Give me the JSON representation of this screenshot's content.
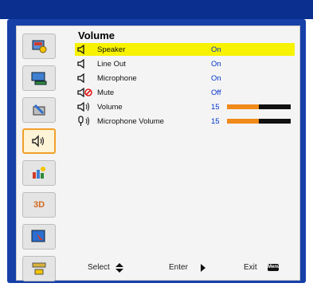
{
  "header": {
    "title": "Volume"
  },
  "sidebar": {
    "items": [
      {
        "icon": "picture-settings-icon",
        "active": false
      },
      {
        "icon": "display-settings-icon",
        "active": false
      },
      {
        "icon": "setup-wrench-icon",
        "active": false
      },
      {
        "icon": "volume-icon",
        "active": true
      },
      {
        "icon": "options-icon",
        "active": false
      },
      {
        "icon": "3d-icon",
        "active": false,
        "text": "3D"
      },
      {
        "icon": "screen-pointer-icon",
        "active": false
      },
      {
        "icon": "network-icon",
        "active": false
      }
    ]
  },
  "menu": {
    "rows": [
      {
        "icon": "speaker-icon",
        "label": "Speaker",
        "value": "On",
        "selected": true
      },
      {
        "icon": "speaker-icon",
        "label": "Line Out",
        "value": "On",
        "selected": false
      },
      {
        "icon": "speaker-icon",
        "label": "Microphone",
        "value": "On",
        "selected": false
      },
      {
        "icon": "mute-icon",
        "label": "Mute",
        "value": "Off",
        "selected": false
      },
      {
        "icon": "volume-level-icon",
        "label": "Volume",
        "value": "15",
        "level": 0.5,
        "selected": false
      },
      {
        "icon": "microphone-volume-icon",
        "label": "Microphone Volume",
        "value": "15",
        "level": 0.5,
        "selected": false
      }
    ]
  },
  "footer": {
    "select_label": "Select",
    "enter_label": "Enter",
    "exit_label": "Exit",
    "menu_key_label": "Menu"
  },
  "colors": {
    "frame": "#1640a8",
    "topbar": "#0b2f8f",
    "selected_row": "#f7f200",
    "value_text": "#0033cc",
    "bar_fill": "#f08a1a",
    "active_border": "#f0a02a"
  }
}
